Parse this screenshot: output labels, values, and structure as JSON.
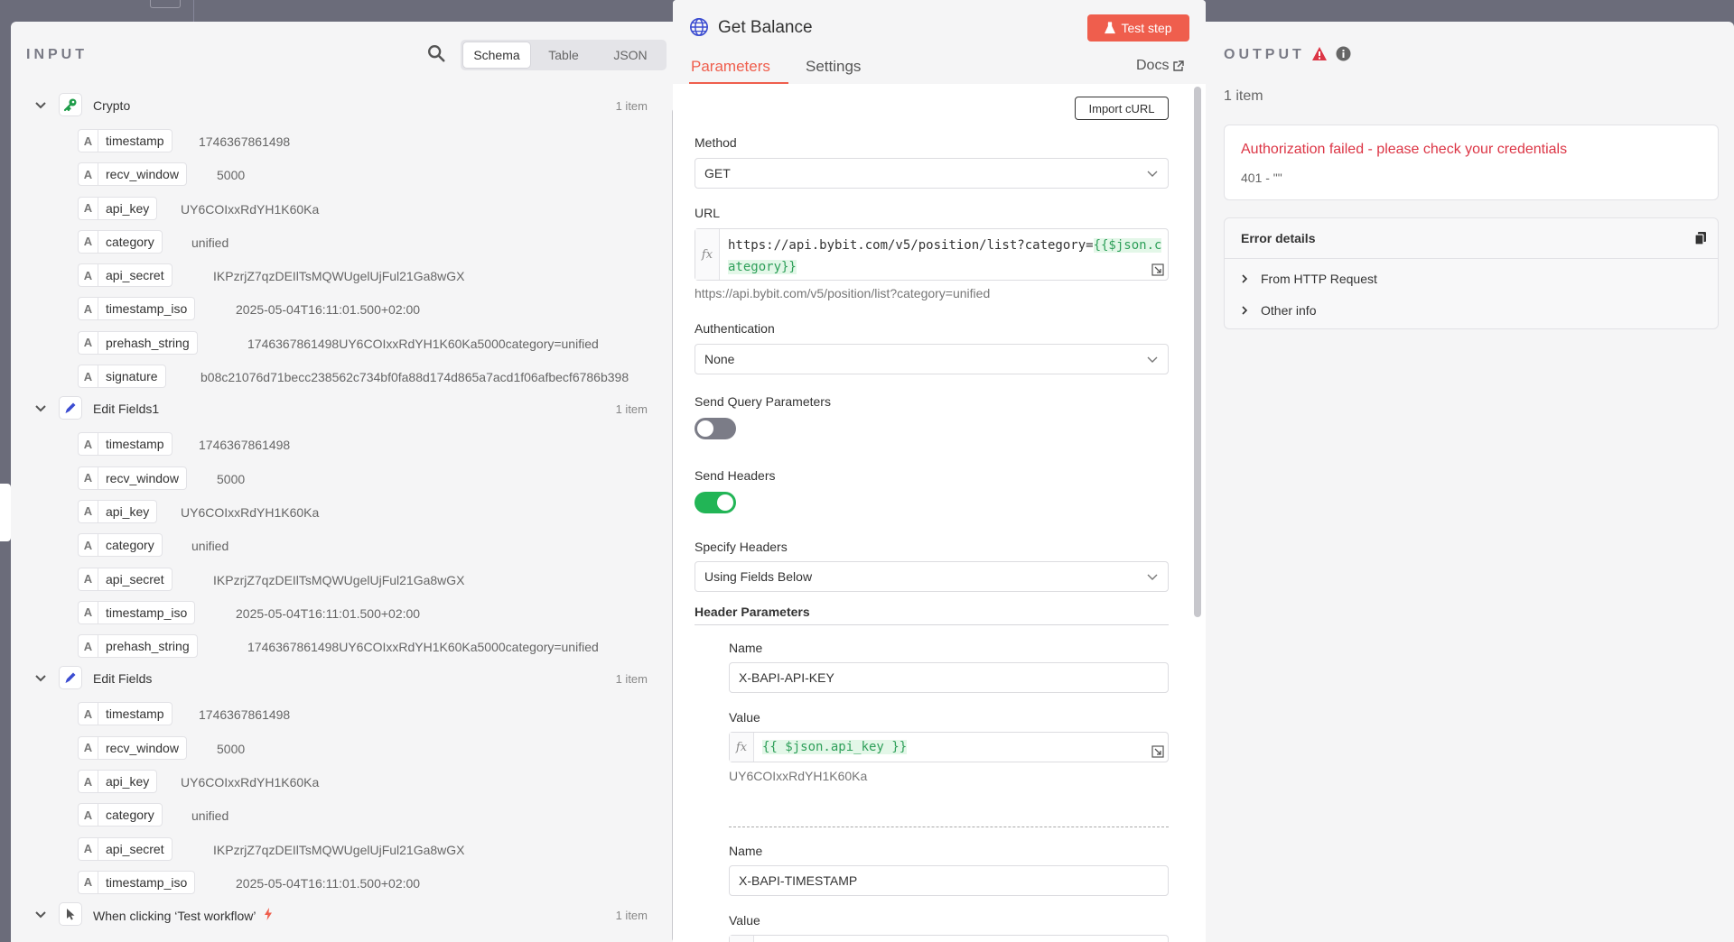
{
  "input": {
    "label": "INPUT",
    "views": [
      "Schema",
      "Table",
      "JSON"
    ],
    "active_view": "Schema",
    "groups": [
      {
        "name": "Crypto",
        "count": "1 item",
        "icon": "key-icon",
        "icon_color": "#1f9d4a",
        "fields": [
          {
            "type": "A",
            "key": "timestamp",
            "value": "1746367861498"
          },
          {
            "type": "A",
            "key": "recv_window",
            "value": "5000"
          },
          {
            "type": "A",
            "key": "api_key",
            "value": "UY6COIxxRdYH1K60Ka"
          },
          {
            "type": "A",
            "key": "category",
            "value": "unified"
          },
          {
            "type": "A",
            "key": "api_secret",
            "value": "IKPzrjZ7qzDEIlTsMQWUgelUjFul21Ga8wGX"
          },
          {
            "type": "A",
            "key": "timestamp_iso",
            "value": "2025-05-04T16:11:01.500+02:00"
          },
          {
            "type": "A",
            "key": "prehash_string",
            "value": "1746367861498UY6COIxxRdYH1K60Ka5000category=unified"
          },
          {
            "type": "A",
            "key": "signature",
            "value": "b08c21076d71becc238562c734bf0fa88d174d865a7acd1f06afbecf6786b398"
          }
        ]
      },
      {
        "name": "Edit Fields1",
        "count": "1 item",
        "icon": "pen-icon",
        "icon_color": "#3b4cd1",
        "fields": [
          {
            "type": "A",
            "key": "timestamp",
            "value": "1746367861498"
          },
          {
            "type": "A",
            "key": "recv_window",
            "value": "5000"
          },
          {
            "type": "A",
            "key": "api_key",
            "value": "UY6COIxxRdYH1K60Ka"
          },
          {
            "type": "A",
            "key": "category",
            "value": "unified"
          },
          {
            "type": "A",
            "key": "api_secret",
            "value": "IKPzrjZ7qzDEIlTsMQWUgelUjFul21Ga8wGX"
          },
          {
            "type": "A",
            "key": "timestamp_iso",
            "value": "2025-05-04T16:11:01.500+02:00"
          },
          {
            "type": "A",
            "key": "prehash_string",
            "value": "1746367861498UY6COIxxRdYH1K60Ka5000category=unified"
          }
        ]
      },
      {
        "name": "Edit Fields",
        "count": "1 item",
        "icon": "pen-icon",
        "icon_color": "#3b4cd1",
        "fields": [
          {
            "type": "A",
            "key": "timestamp",
            "value": "1746367861498"
          },
          {
            "type": "A",
            "key": "recv_window",
            "value": "5000"
          },
          {
            "type": "A",
            "key": "api_key",
            "value": "UY6COIxxRdYH1K60Ka"
          },
          {
            "type": "A",
            "key": "category",
            "value": "unified"
          },
          {
            "type": "A",
            "key": "api_secret",
            "value": "IKPzrjZ7qzDEIlTsMQWUgelUjFul21Ga8wGX"
          },
          {
            "type": "A",
            "key": "timestamp_iso",
            "value": "2025-05-04T16:11:01.500+02:00"
          }
        ]
      },
      {
        "name": "When clicking ‘Test workflow’",
        "count": "1 item",
        "icon": "cursor-icon",
        "icon_color": "#555555",
        "trigger_icon": "bolt-icon",
        "fields": []
      }
    ]
  },
  "node": {
    "title": "Get Balance",
    "test_step_label": "Test step",
    "tabs": [
      "Parameters",
      "Settings"
    ],
    "active_tab": "Parameters",
    "docs_label": "Docs",
    "import_curl_label": "Import cURL",
    "method": {
      "label": "Method",
      "value": "GET"
    },
    "url": {
      "label": "URL",
      "prefix": "https://api.bybit.com/v5/position/list?category=",
      "expression": "{{$json.category}}",
      "resolved": "https://api.bybit.com/v5/position/list?category=unified"
    },
    "authentication": {
      "label": "Authentication",
      "value": "None"
    },
    "send_query": {
      "label": "Send Query Parameters",
      "on": false
    },
    "send_headers": {
      "label": "Send Headers",
      "on": true
    },
    "specify_headers": {
      "label": "Specify Headers",
      "value": "Using Fields Below"
    },
    "header_parameters": {
      "title": "Header Parameters",
      "items": [
        {
          "name_label": "Name",
          "name": "X-BAPI-API-KEY",
          "value_label": "Value",
          "value_expr": "{{ $json.api_key }}",
          "value_resolved": "UY6COIxxRdYH1K60Ka"
        },
        {
          "name_label": "Name",
          "name": "X-BAPI-TIMESTAMP",
          "value_label": "Value"
        }
      ]
    },
    "accent_color": "#ef5e4d"
  },
  "output": {
    "label": "OUTPUT",
    "count": "1 item",
    "error_title": "Authorization failed - please check your credentials",
    "error_code": "401 - \"\"",
    "details_title": "Error details",
    "details_items": [
      "From HTTP Request",
      "Other info"
    ],
    "error_color": "#dc3545"
  }
}
